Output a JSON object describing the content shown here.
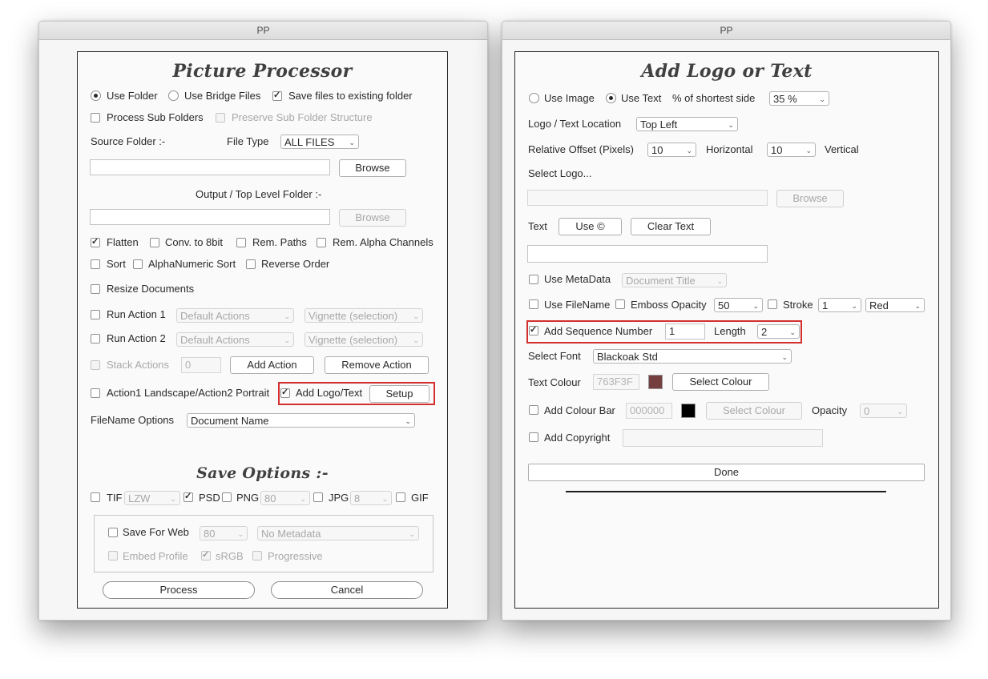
{
  "left": {
    "window_title": "PP",
    "heading": "Picture Processor",
    "use_folder": "Use Folder",
    "use_bridge_files": "Use Bridge Files",
    "save_existing": "Save files to existing folder",
    "process_sub_folders": "Process Sub Folders",
    "preserve_sub_folder": "Preserve Sub Folder Structure",
    "source_folder": "Source Folder :-",
    "file_type_label": "File Type",
    "file_type_value": "ALL FILES",
    "source_path": "",
    "browse": "Browse",
    "output_folder": "Output / Top Level Folder :-",
    "output_path": "",
    "browse2": "Browse",
    "flatten": "Flatten",
    "conv_8bit": "Conv. to 8bit",
    "rem_paths": "Rem. Paths",
    "rem_alpha": "Rem. Alpha Channels",
    "sort": "Sort",
    "alpha_sort": "AlphaNumeric Sort",
    "reverse_order": "Reverse Order",
    "resize_docs": "Resize Documents",
    "run_action1": "Run Action 1",
    "action1_set": "Default Actions",
    "action1_action": "Vignette (selection)",
    "run_action2": "Run Action 2",
    "action2_set": "Default Actions",
    "action2_action": "Vignette (selection)",
    "stack_actions": "Stack Actions",
    "stack_value": "0",
    "add_action": "Add Action",
    "remove_action": "Remove Action",
    "landscape_portrait": "Action1 Landscape/Action2 Portrait",
    "add_logo_text": "Add Logo/Text",
    "setup": "Setup",
    "filename_options": "FileName Options",
    "filename_value": "Document Name",
    "save_heading": "Save Options :-",
    "tif": "TIF",
    "tif_comp": "LZW",
    "psd": "PSD",
    "png": "PNG",
    "png_q": "80",
    "jpg": "JPG",
    "jpg_q": "8",
    "gif": "GIF",
    "save_for_web": "Save For Web",
    "web_q": "80",
    "metadata": "No Metadata",
    "embed_profile": "Embed Profile",
    "srgb": "sRGB",
    "progressive": "Progressive",
    "process": "Process",
    "cancel": "Cancel"
  },
  "right": {
    "window_title": "PP",
    "heading": "Add Logo or Text",
    "use_image": "Use Image",
    "use_text": "Use Text",
    "pct_label": "% of shortest side",
    "pct_value": "35 %",
    "location_label": "Logo / Text Location",
    "location_value": "Top Left",
    "offset_label": "Relative Offset (Pixels)",
    "horiz_value": "10",
    "horizontal": "Horizontal",
    "vert_value": "10",
    "vertical": "Vertical",
    "select_logo": "Select Logo...",
    "logo_path": "",
    "browse": "Browse",
    "text_label": "Text",
    "use_copyright": "Use ©",
    "clear_text": "Clear Text",
    "text_value": "",
    "use_metadata": "Use MetaData",
    "metadata_value": "Document Title",
    "use_filename": "Use FileName",
    "emboss_opacity": "Emboss Opacity",
    "emboss_value": "50",
    "stroke": "Stroke",
    "stroke_width": "1",
    "stroke_color": "Red",
    "add_sequence": "Add Sequence Number",
    "sequence_value": "1",
    "length_label": "Length",
    "length_value": "2",
    "select_font": "Select Font",
    "font_value": "Blackoak Std",
    "text_colour": "Text Colour",
    "colour_hex": "763F3F",
    "colour_swatch": "#763F3F",
    "select_colour": "Select Colour",
    "add_colour_bar": "Add Colour Bar",
    "bar_hex": "000000",
    "bar_swatch": "#000000",
    "select_colour2": "Select Colour",
    "opacity_label": "Opacity",
    "opacity_value": "0",
    "add_copyright": "Add Copyright",
    "copyright_value": "",
    "done": "Done"
  },
  "colors": {
    "highlight_border": "#d32f2f"
  }
}
